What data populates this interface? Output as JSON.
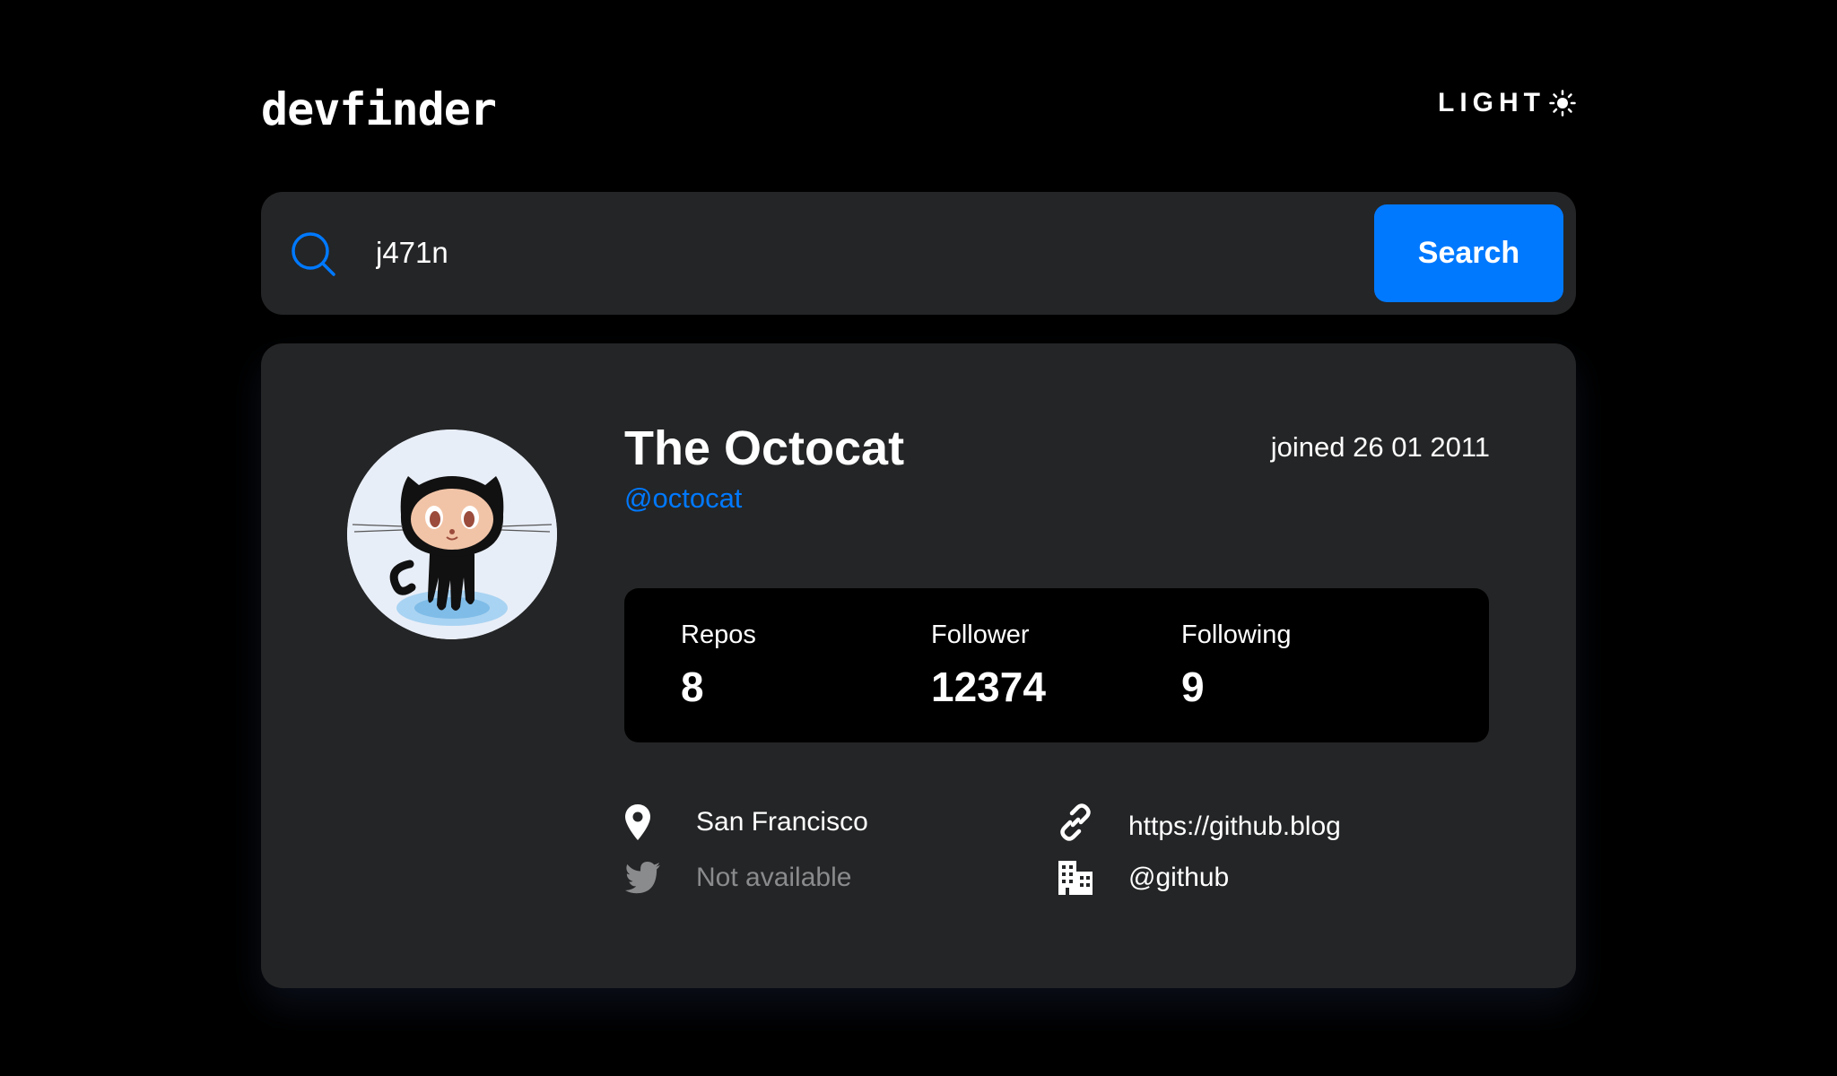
{
  "header": {
    "logo": "devfinder",
    "theme_toggle_label": "LIGHT",
    "theme_icon": "sun-icon"
  },
  "search": {
    "value": "j471n",
    "placeholder": "",
    "button_label": "Search",
    "icon": "search-icon"
  },
  "profile": {
    "name": "The Octocat",
    "login": "@octocat",
    "joined": "joined 26 01 2011",
    "avatar": "octocat-avatar",
    "stats": [
      {
        "label": "Repos",
        "value": "8"
      },
      {
        "label": "Follower",
        "value": "12374"
      },
      {
        "label": "Following",
        "value": "9"
      }
    ],
    "links": {
      "location": {
        "icon": "location-pin-icon",
        "text": "San Francisco"
      },
      "blog": {
        "icon": "link-icon",
        "text": "https://github.blog"
      },
      "twitter": {
        "icon": "twitter-icon",
        "text": "Not available"
      },
      "company": {
        "icon": "building-icon",
        "text": "@github"
      }
    }
  },
  "colors": {
    "background": "#000000",
    "card": "#242526",
    "accent": "#0079ff",
    "muted": "#8a8b8c",
    "text": "#ffffff"
  }
}
